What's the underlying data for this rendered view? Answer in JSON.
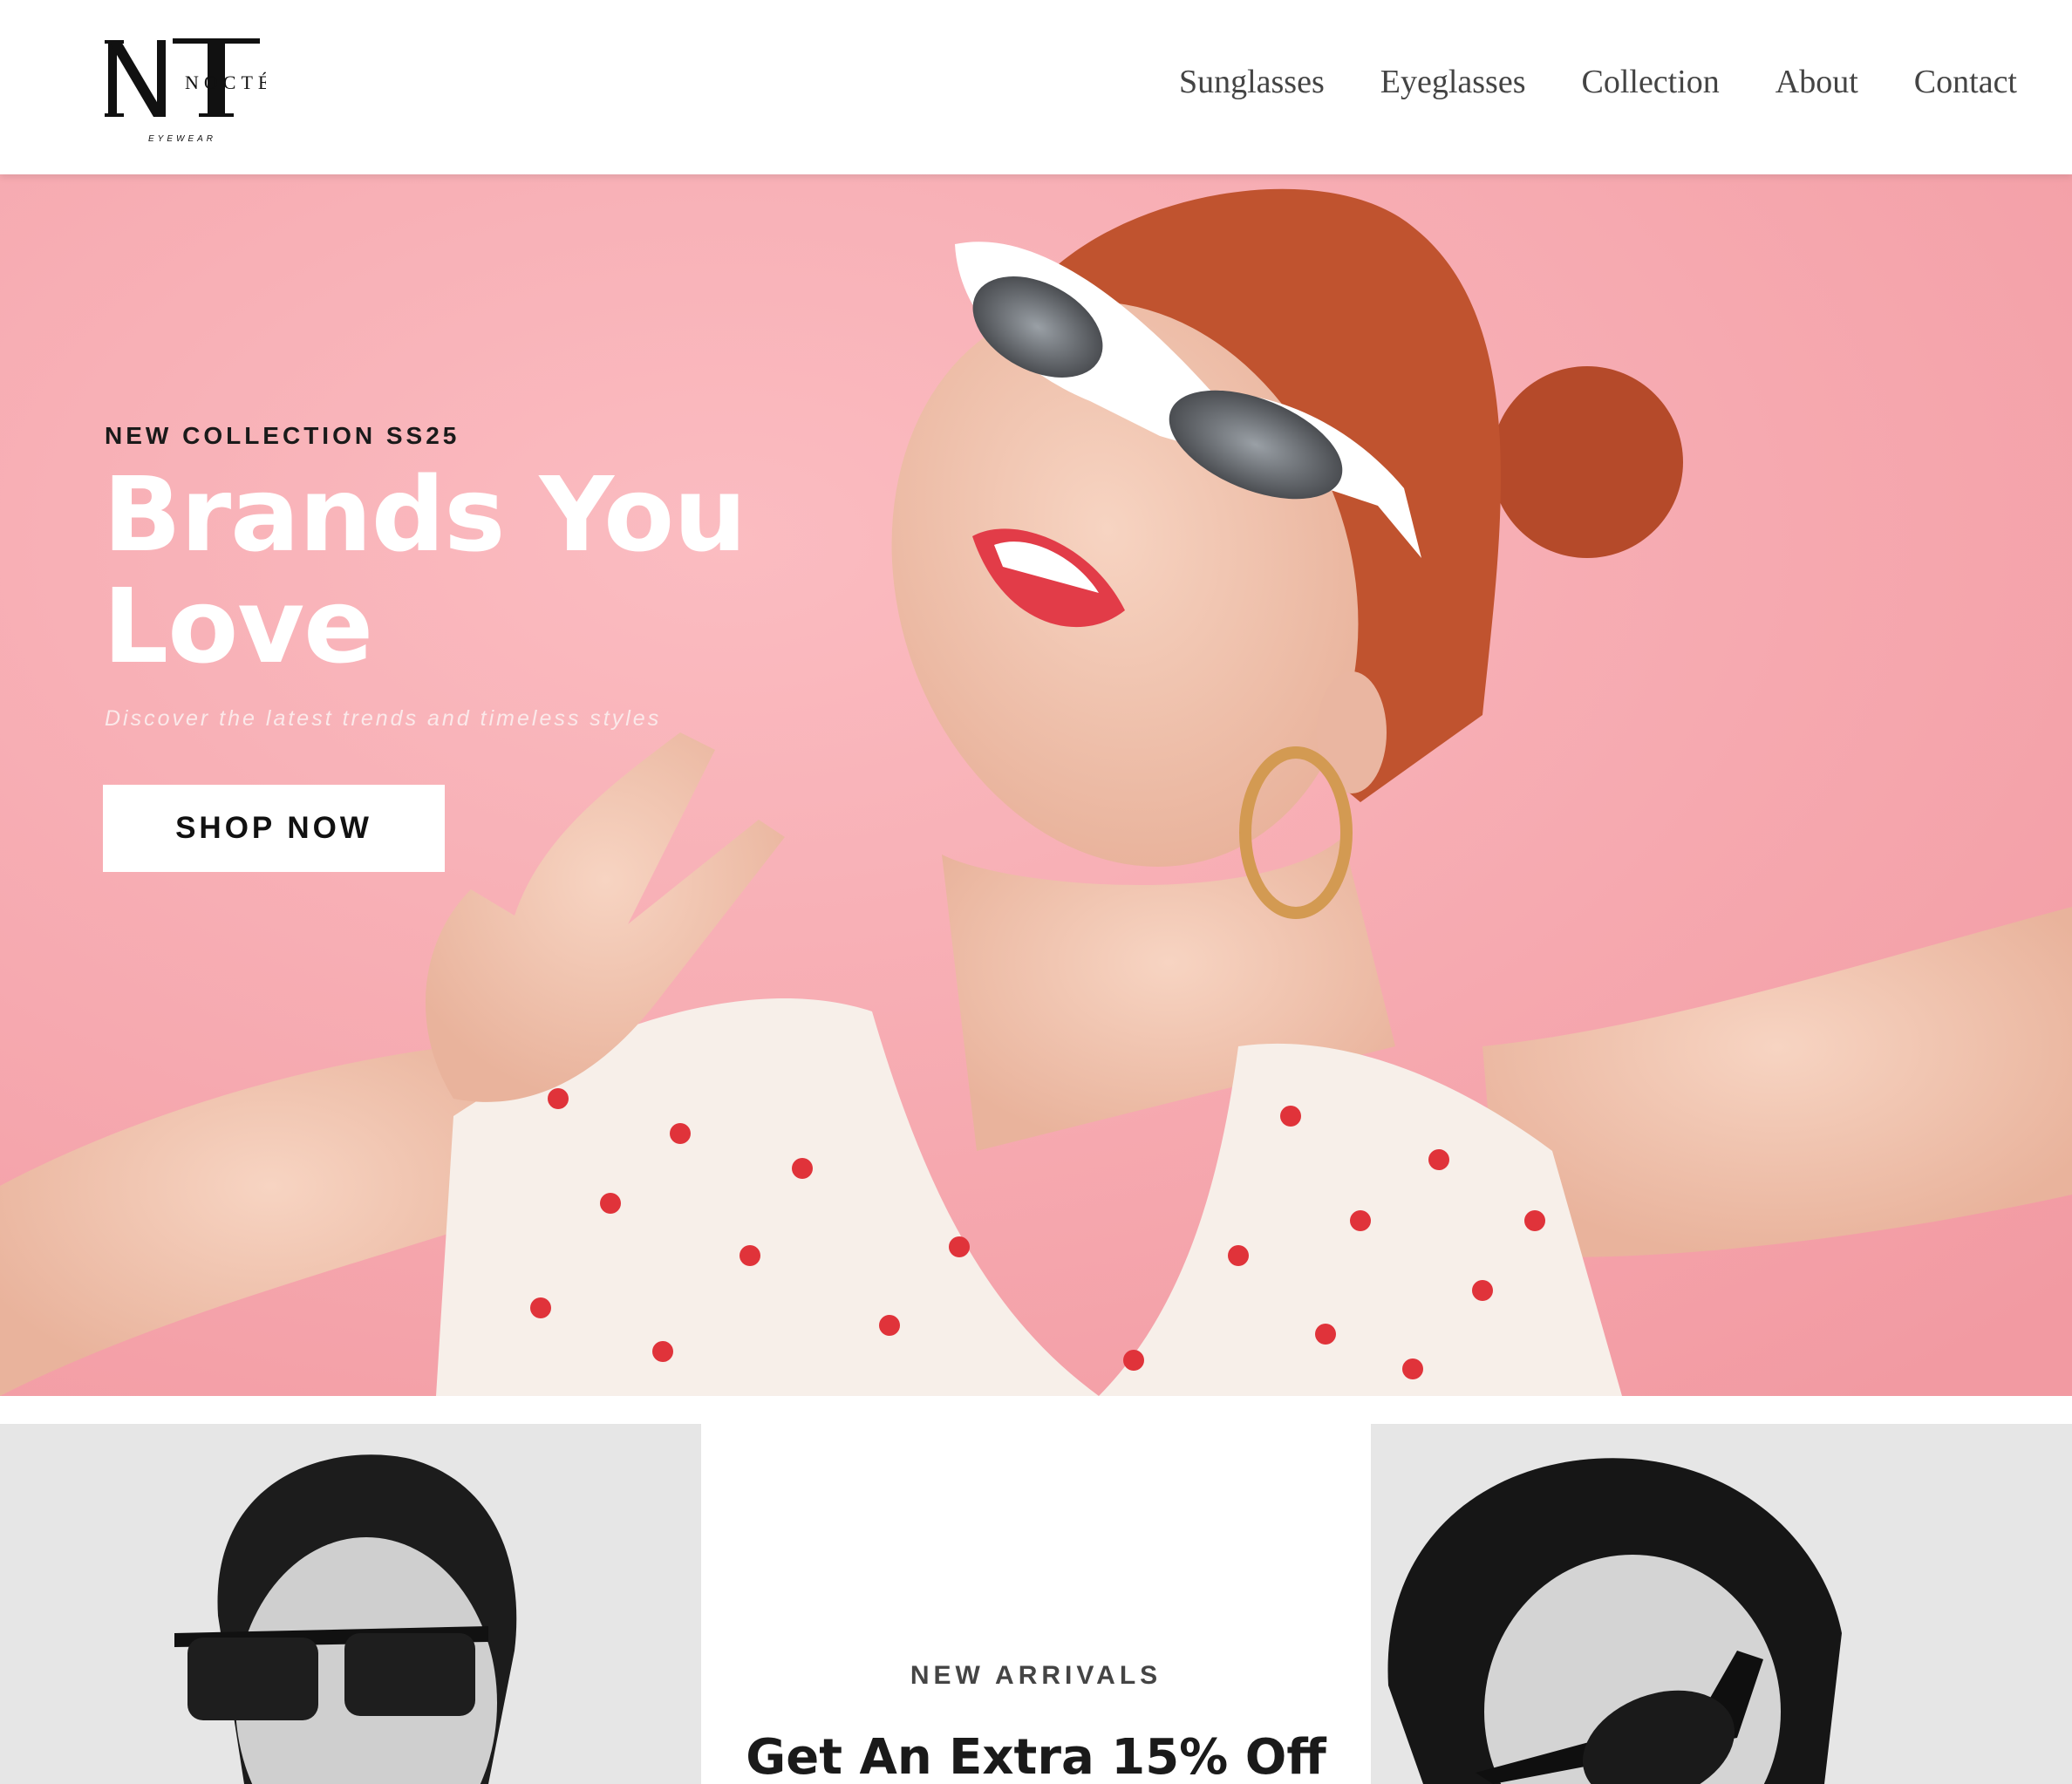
{
  "brand": {
    "logo_letters": "NT",
    "logo_name": "NOCTÉ",
    "logo_tagline": "EYEWEAR"
  },
  "nav": {
    "items": [
      {
        "label": "Sunglasses"
      },
      {
        "label": "Eyeglasses"
      },
      {
        "label": "Collection"
      },
      {
        "label": "About"
      },
      {
        "label": "Contact"
      }
    ]
  },
  "hero": {
    "eyebrow": "NEW COLLECTION SS25",
    "title_line1": "Brands You",
    "title_line2": "Love",
    "subtitle": "Discover the latest trends and timeless styles",
    "cta_label": "SHOP NOW",
    "background_color": "#f6a8ae"
  },
  "promo": {
    "eyebrow": "NEW ARRIVALS",
    "title": "Get An Extra 15% Off"
  },
  "colors": {
    "text_dark": "#1a1a1a",
    "nav_text": "#444444",
    "hero_pink": "#f6a8ae",
    "white": "#ffffff"
  }
}
